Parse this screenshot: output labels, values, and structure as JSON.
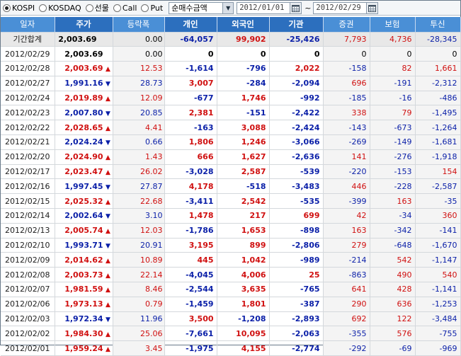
{
  "toolbar": {
    "options": [
      {
        "label": "KOSPI",
        "checked": true
      },
      {
        "label": "KOSDAQ",
        "checked": false
      },
      {
        "label": "선물",
        "checked": false
      },
      {
        "label": "Call",
        "checked": false
      },
      {
        "label": "Put",
        "checked": false
      }
    ],
    "select_value": "순매수금액",
    "date_from": "2012/01/01",
    "date_to": "2012/02/29",
    "range_separator": "~"
  },
  "table": {
    "headers": [
      "일자",
      "주가",
      "등락폭",
      "개인",
      "외국인",
      "기관",
      "증권",
      "보험",
      "투신"
    ],
    "summary": {
      "date": "기간합계",
      "price": "2,003.69",
      "change": "0.00",
      "dir": "flat",
      "individual": "-64,057",
      "foreign": "99,902",
      "institution": "-25,426",
      "securities": "7,793",
      "insurance": "4,736",
      "trust": "-28,345"
    },
    "rows": [
      {
        "date": "2012/02/29",
        "price": "2,003.69",
        "change": "0.00",
        "dir": "flat",
        "individual": "0",
        "foreign": "0",
        "institution": "0",
        "securities": "0",
        "insurance": "0",
        "trust": "0"
      },
      {
        "date": "2012/02/28",
        "price": "2,003.69",
        "change": "12.53",
        "dir": "up",
        "individual": "-1,614",
        "foreign": "-796",
        "institution": "2,022",
        "securities": "-158",
        "insurance": "82",
        "trust": "1,661"
      },
      {
        "date": "2012/02/27",
        "price": "1,991.16",
        "change": "28.73",
        "dir": "down",
        "individual": "3,007",
        "foreign": "-284",
        "institution": "-2,094",
        "securities": "696",
        "insurance": "-191",
        "trust": "-2,312"
      },
      {
        "date": "2012/02/24",
        "price": "2,019.89",
        "change": "12.09",
        "dir": "up",
        "individual": "-677",
        "foreign": "1,746",
        "institution": "-992",
        "securities": "-185",
        "insurance": "-16",
        "trust": "-486"
      },
      {
        "date": "2012/02/23",
        "price": "2,007.80",
        "change": "20.85",
        "dir": "down",
        "individual": "2,381",
        "foreign": "-151",
        "institution": "-2,422",
        "securities": "338",
        "insurance": "79",
        "trust": "-1,495"
      },
      {
        "date": "2012/02/22",
        "price": "2,028.65",
        "change": "4.41",
        "dir": "up",
        "individual": "-163",
        "foreign": "3,088",
        "institution": "-2,424",
        "securities": "-143",
        "insurance": "-673",
        "trust": "-1,264"
      },
      {
        "date": "2012/02/21",
        "price": "2,024.24",
        "change": "0.66",
        "dir": "down",
        "individual": "1,806",
        "foreign": "1,246",
        "institution": "-3,066",
        "securities": "-269",
        "insurance": "-149",
        "trust": "-1,681"
      },
      {
        "date": "2012/02/20",
        "price": "2,024.90",
        "change": "1.43",
        "dir": "up",
        "individual": "666",
        "foreign": "1,627",
        "institution": "-2,636",
        "securities": "141",
        "insurance": "-276",
        "trust": "-1,918"
      },
      {
        "date": "2012/02/17",
        "price": "2,023.47",
        "change": "26.02",
        "dir": "up",
        "individual": "-3,028",
        "foreign": "2,587",
        "institution": "-539",
        "securities": "-220",
        "insurance": "-153",
        "trust": "154"
      },
      {
        "date": "2012/02/16",
        "price": "1,997.45",
        "change": "27.87",
        "dir": "down",
        "individual": "4,178",
        "foreign": "-518",
        "institution": "-3,483",
        "securities": "446",
        "insurance": "-228",
        "trust": "-2,587"
      },
      {
        "date": "2012/02/15",
        "price": "2,025.32",
        "change": "22.68",
        "dir": "up",
        "individual": "-3,411",
        "foreign": "2,542",
        "institution": "-535",
        "securities": "-399",
        "insurance": "163",
        "trust": "-35"
      },
      {
        "date": "2012/02/14",
        "price": "2,002.64",
        "change": "3.10",
        "dir": "down",
        "individual": "1,478",
        "foreign": "217",
        "institution": "699",
        "securities": "42",
        "insurance": "-34",
        "trust": "360"
      },
      {
        "date": "2012/02/13",
        "price": "2,005.74",
        "change": "12.03",
        "dir": "up",
        "individual": "-1,786",
        "foreign": "1,653",
        "institution": "-898",
        "securities": "163",
        "insurance": "-342",
        "trust": "-141"
      },
      {
        "date": "2012/02/10",
        "price": "1,993.71",
        "change": "20.91",
        "dir": "down",
        "individual": "3,195",
        "foreign": "899",
        "institution": "-2,806",
        "securities": "279",
        "insurance": "-648",
        "trust": "-1,670"
      },
      {
        "date": "2012/02/09",
        "price": "2,014.62",
        "change": "10.89",
        "dir": "up",
        "individual": "445",
        "foreign": "1,042",
        "institution": "-989",
        "securities": "-214",
        "insurance": "542",
        "trust": "-1,147"
      },
      {
        "date": "2012/02/08",
        "price": "2,003.73",
        "change": "22.14",
        "dir": "up",
        "individual": "-4,045",
        "foreign": "4,006",
        "institution": "25",
        "securities": "-863",
        "insurance": "490",
        "trust": "540"
      },
      {
        "date": "2012/02/07",
        "price": "1,981.59",
        "change": "8.46",
        "dir": "up",
        "individual": "-2,544",
        "foreign": "3,635",
        "institution": "-765",
        "securities": "641",
        "insurance": "428",
        "trust": "-1,141"
      },
      {
        "date": "2012/02/06",
        "price": "1,973.13",
        "change": "0.79",
        "dir": "up",
        "individual": "-1,459",
        "foreign": "1,801",
        "institution": "-387",
        "securities": "290",
        "insurance": "636",
        "trust": "-1,253"
      },
      {
        "date": "2012/02/03",
        "price": "1,972.34",
        "change": "11.96",
        "dir": "down",
        "individual": "3,500",
        "foreign": "-1,208",
        "institution": "-2,893",
        "securities": "692",
        "insurance": "122",
        "trust": "-3,484"
      },
      {
        "date": "2012/02/02",
        "price": "1,984.30",
        "change": "25.06",
        "dir": "up",
        "individual": "-7,661",
        "foreign": "10,095",
        "institution": "-2,063",
        "securities": "-355",
        "insurance": "576",
        "trust": "-755"
      },
      {
        "date": "2012/02/01",
        "price": "1,959.24",
        "change": "3.45",
        "dir": "up",
        "individual": "-1,975",
        "foreign": "4,155",
        "institution": "-2,774",
        "securities": "-292",
        "insurance": "-69",
        "trust": "-969"
      }
    ]
  },
  "colors": {
    "up": "#d01010",
    "down": "#0a1fa8",
    "header": "#4a8fd6",
    "header_dark": "#2c6fbe",
    "summary_bg": "#e8e8e8"
  },
  "icons": {
    "select": "dropdown-arrow-icon",
    "calendar": "calendar-icon"
  }
}
